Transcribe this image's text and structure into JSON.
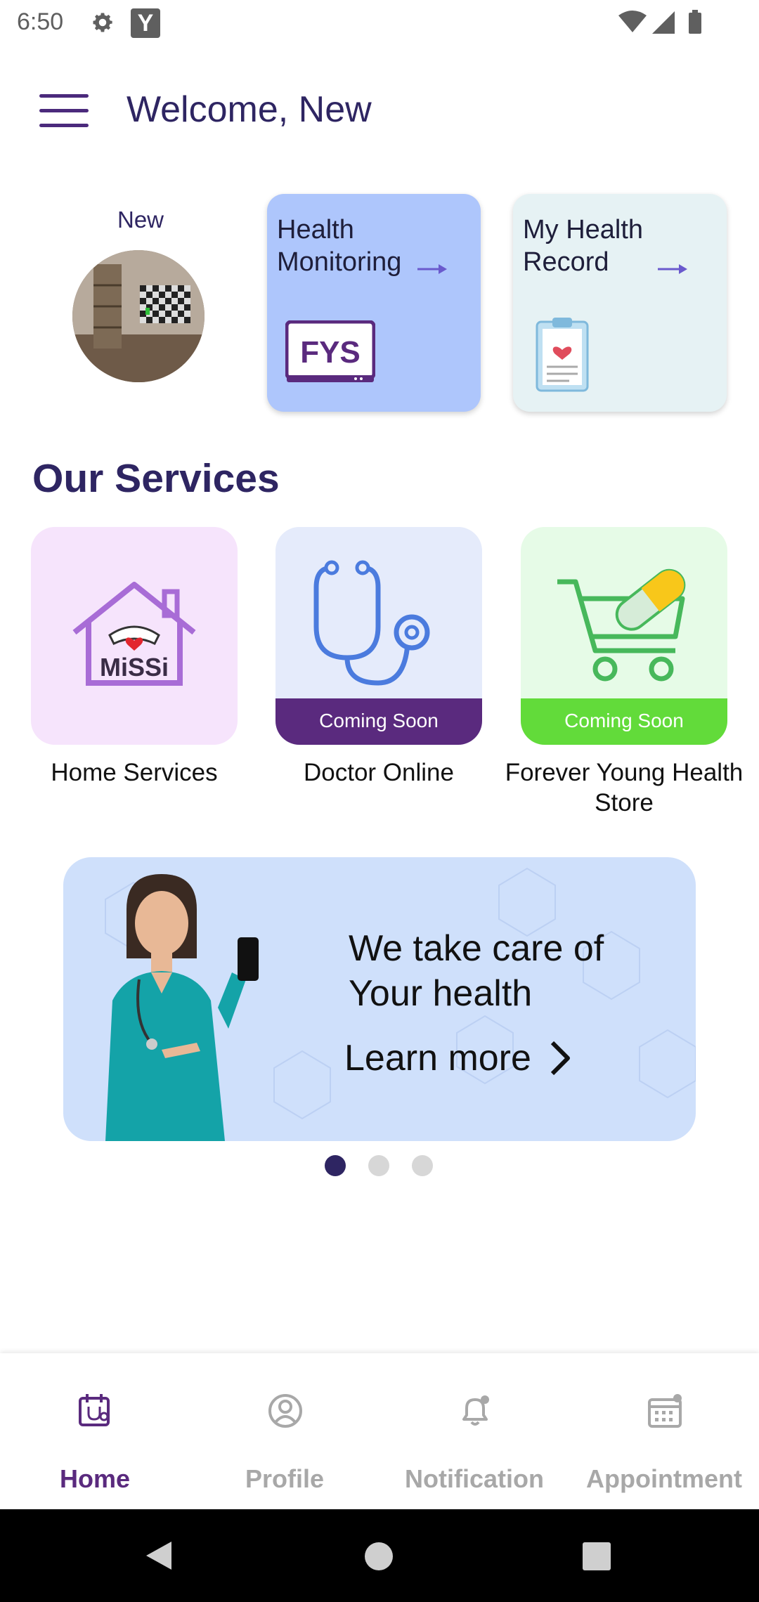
{
  "status_bar": {
    "time": "6:50",
    "app_icon_letter": "Y"
  },
  "header": {
    "title": "Welcome, New",
    "menu_icon": "hamburger-menu-icon"
  },
  "profile": {
    "name": "New"
  },
  "feature_cards": [
    {
      "label": "Health Monitoring",
      "logo_text": "FYS",
      "color": "#aec6fc"
    },
    {
      "label": "My Health Record",
      "color": "#e6f2f4"
    }
  ],
  "services": {
    "title": "Our Services",
    "items": [
      {
        "label": "Home Services",
        "logo_text": "MiSSi",
        "badge": ""
      },
      {
        "label": "Doctor Online",
        "badge": "Coming Soon"
      },
      {
        "label": "Forever Young Health Store",
        "badge": "Coming Soon"
      }
    ]
  },
  "banner": {
    "heading": "We take care of Your health",
    "cta": "Learn more"
  },
  "carousel": {
    "active_index": 0,
    "count": 3
  },
  "bottom_nav": {
    "items": [
      {
        "label": "Home",
        "icon": "home-calendar-icon",
        "active": true
      },
      {
        "label": "Profile",
        "icon": "profile-icon",
        "active": false
      },
      {
        "label": "Notification",
        "icon": "bell-icon",
        "active": false
      },
      {
        "label": "Appointment",
        "icon": "calendar-icon",
        "active": false
      }
    ]
  },
  "colors": {
    "accent": "#5a2a7e",
    "title": "#2e2562",
    "green": "#62db3a"
  }
}
